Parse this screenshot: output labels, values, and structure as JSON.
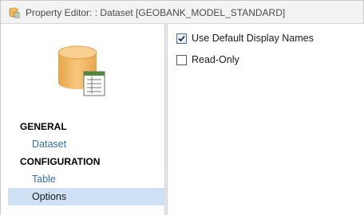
{
  "window": {
    "title": "Property Editor: : Dataset [GEOBANK_MODEL_STANDARD]",
    "app_icon": "database-app-icon"
  },
  "sidebar": {
    "hero_icon": "database-table-icon",
    "sections": [
      {
        "heading": "GENERAL",
        "items": [
          {
            "label": "Dataset",
            "selected": false
          }
        ]
      },
      {
        "heading": "CONFIGURATION",
        "items": [
          {
            "label": "Table",
            "selected": false
          },
          {
            "label": "Options",
            "selected": true
          }
        ]
      }
    ]
  },
  "options": [
    {
      "label": "Use Default Display Names",
      "checked": true
    },
    {
      "label": "Read-Only",
      "checked": false
    }
  ],
  "colors": {
    "link": "#2e6db7",
    "selection": "#cfe2f5",
    "db_gold": "#f2b45c"
  }
}
